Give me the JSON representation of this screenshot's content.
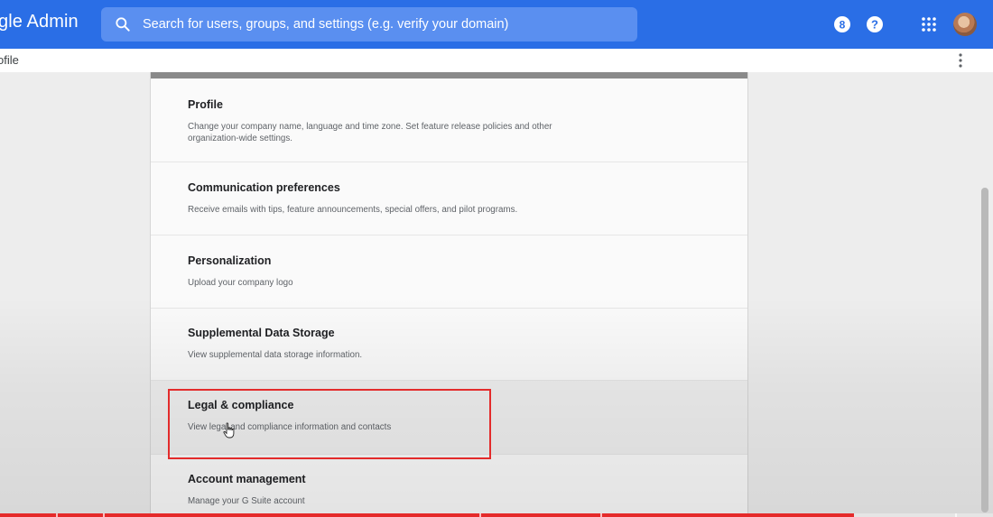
{
  "header": {
    "brand": "gle Admin",
    "search_placeholder": "Search for users, groups, and settings (e.g. verify your domain)",
    "icons": [
      "search-icon",
      "support-8-icon",
      "help-icon",
      "apps-grid-icon",
      "avatar"
    ]
  },
  "breadcrumb": {
    "text": "ofile"
  },
  "settings": {
    "items": [
      {
        "title": "Profile",
        "description": "Change your company name, language and time zone. Set feature release policies and other organization-wide settings."
      },
      {
        "title": "Communication preferences",
        "description": "Receive emails with tips, feature announcements, special offers, and pilot programs."
      },
      {
        "title": "Personalization",
        "description": "Upload your company logo"
      },
      {
        "title": "Supplemental Data Storage",
        "description": "View supplemental data storage information."
      },
      {
        "title": "Legal & compliance",
        "description": "View legal and compliance information and contacts"
      },
      {
        "title": "Account management",
        "description": "Manage your G Suite account"
      }
    ]
  },
  "colors": {
    "header_bg": "#2a6ee6",
    "highlight": "#e32b2b"
  },
  "video_progress": 0.86
}
